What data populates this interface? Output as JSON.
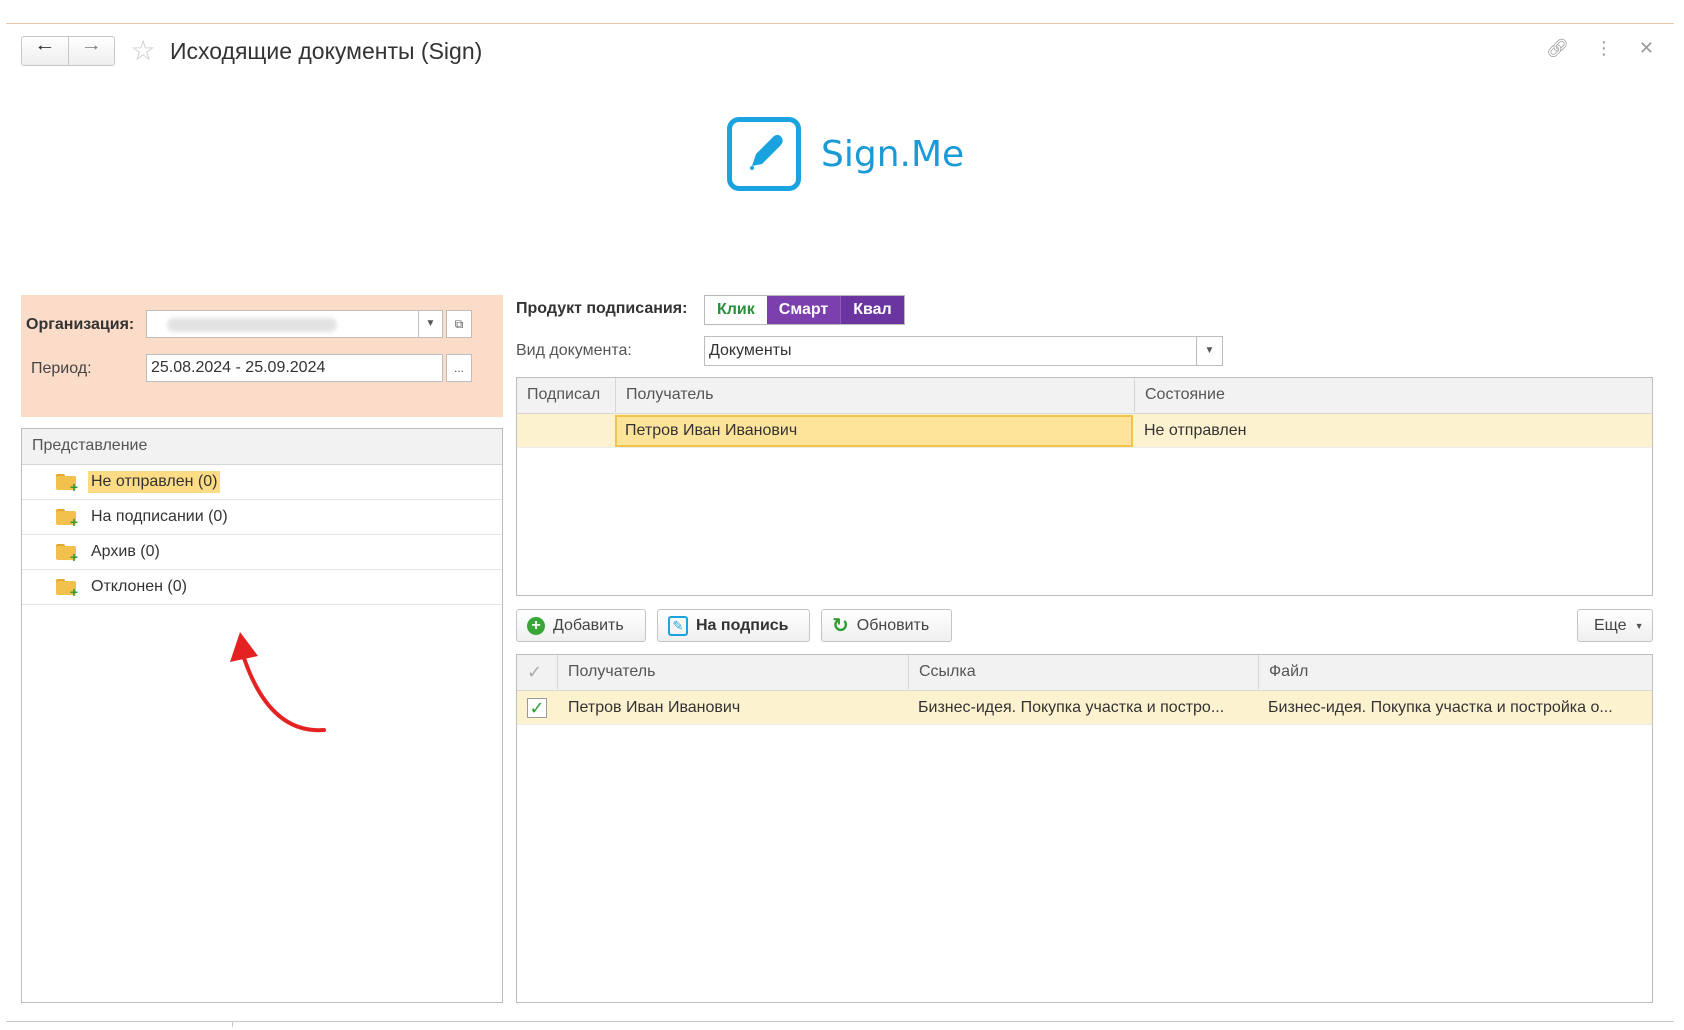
{
  "window": {
    "title": "Исходящие документы (Sign)"
  },
  "logo": {
    "text": "Sign.Me"
  },
  "filter": {
    "org_label": "Организация:",
    "period_label": "Период:",
    "period_value": "25.08.2024 - 25.09.2024",
    "period_button": "..."
  },
  "tree": {
    "header": "Представление",
    "items": [
      {
        "label": "Не отправлен (0)",
        "selected": true
      },
      {
        "label": "На подписании (0)",
        "selected": false
      },
      {
        "label": "Архив (0)",
        "selected": false
      },
      {
        "label": "Отклонен (0)",
        "selected": false
      }
    ]
  },
  "product": {
    "label": "Продукт подписания:",
    "options": [
      "Клик",
      "Смарт",
      "Квал"
    ]
  },
  "doc_type": {
    "label": "Вид документа:",
    "value": "Документы"
  },
  "top_grid": {
    "columns": [
      "Подписал",
      "Получатель",
      "Состояние"
    ],
    "rows": [
      {
        "signed": "",
        "recipient": "Петров Иван Иванович",
        "status": "Не отправлен"
      }
    ]
  },
  "toolbar": {
    "add": "Добавить",
    "sign": "На подпись",
    "refresh": "Обновить",
    "more": "Еще"
  },
  "bottom_grid": {
    "columns": [
      "Получатель",
      "Ссылка",
      "Файл"
    ],
    "rows": [
      {
        "checked": true,
        "recipient": "Петров Иван Иванович",
        "link": "Бизнес-идея. Покупка участка и постро...",
        "file": "Бизнес-идея. Покупка участка и постройка о..."
      }
    ]
  },
  "colors": {
    "filter_bg": "#fbdcc8",
    "accent_purple": "#7b3fae",
    "logo_blue": "#1aa3df",
    "selection_yellow": "#fddc85"
  }
}
